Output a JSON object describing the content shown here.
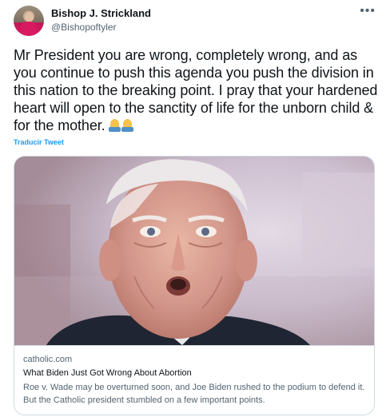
{
  "author": {
    "display_name": "Bishop J. Strickland",
    "handle": "@Bishopoftyler"
  },
  "more_icon": "more-horizontal-icon",
  "tweet": {
    "text": "Mr President you are wrong, completely wrong, and as you continue to push this agenda you push the division in this nation to the breaking point. I pray that your hardened heart will open to the sanctity of life for the unborn child & for the mother.",
    "emoji": [
      "folded-hands-emoji",
      "folded-hands-emoji"
    ],
    "translate_label": "Traducir Tweet"
  },
  "card": {
    "image_icon": "article-photo",
    "domain": "catholic.com",
    "title": "What Biden Just Got Wrong About Abortion",
    "description": "Roe v. Wade may be overturned soon, and Joe Biden rushed to the podium to defend it. But the Catholic president stumbled on a few important points."
  }
}
